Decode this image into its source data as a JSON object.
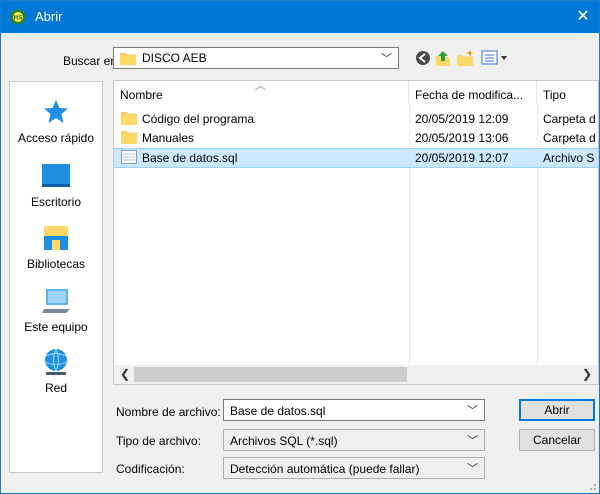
{
  "window": {
    "title": "Abrir",
    "close_glyph": "✕"
  },
  "lookin": {
    "label": "Buscar en:",
    "value": "DISCO AEB"
  },
  "toolbar": {
    "icons": [
      "back-icon",
      "up-folder-icon",
      "new-folder-icon",
      "view-menu-icon"
    ]
  },
  "places": [
    {
      "label": "Acceso rápido",
      "icon": "star-icon"
    },
    {
      "label": "Escritorio",
      "icon": "desktop-icon"
    },
    {
      "label": "Bibliotecas",
      "icon": "libraries-icon"
    },
    {
      "label": "Este equipo",
      "icon": "computer-icon"
    },
    {
      "label": "Red",
      "icon": "network-icon"
    }
  ],
  "list": {
    "headers": {
      "name": "Nombre",
      "date": "Fecha de modifica...",
      "type": "Tipo"
    },
    "rows": [
      {
        "name": "Código del programa",
        "date": "20/05/2019 12:09",
        "type": "Carpeta d",
        "icon": "folder-icon",
        "selected": false
      },
      {
        "name": "Manuales",
        "date": "20/05/2019 13:06",
        "type": "Carpeta d",
        "icon": "folder-icon",
        "selected": false
      },
      {
        "name": "Base de datos.sql",
        "date": "20/05/2019 12:07",
        "type": "Archivo S",
        "icon": "sql-file-icon",
        "selected": true
      }
    ]
  },
  "form": {
    "filename_label": "Nombre de archivo:",
    "filename_value": "Base de datos.sql",
    "filetype_label": "Tipo de archivo:",
    "filetype_value": "Archivos SQL (*.sql)",
    "encoding_label": "Codificación:",
    "encoding_value": "Detección automática (puede fallar)"
  },
  "buttons": {
    "open": "Abrir",
    "cancel": "Cancelar"
  },
  "colors": {
    "titlebar": "#0078d7",
    "selection": "#cce8ff",
    "folder": "#ffd966"
  }
}
